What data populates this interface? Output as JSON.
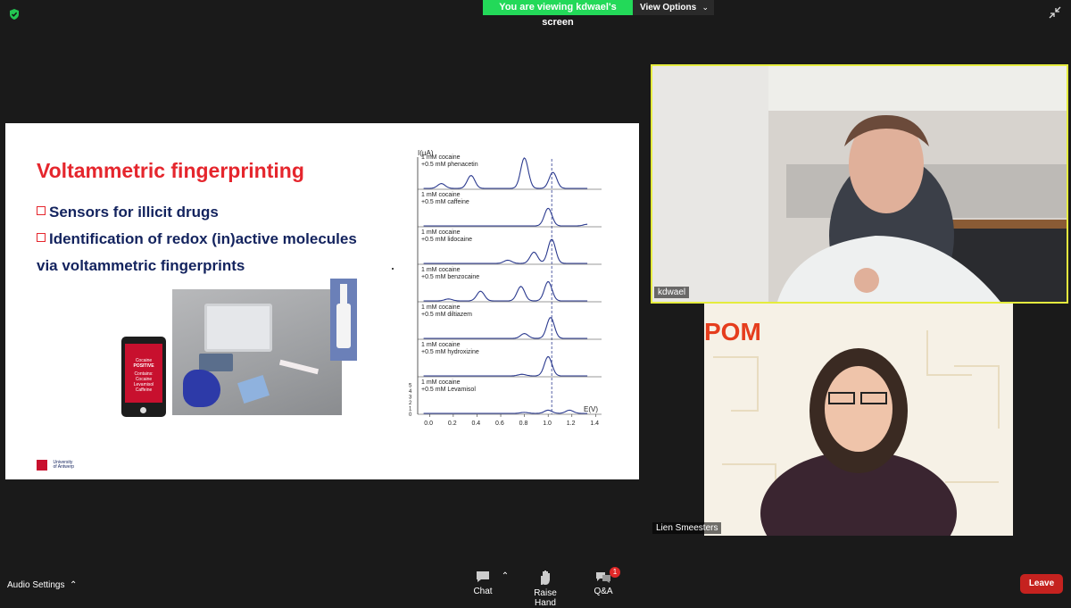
{
  "top_bar": {
    "viewing_banner": "You are viewing kdwael's screen",
    "view_options": "View Options",
    "security_icon": "shield-check-icon",
    "fullscreen_icon": "exit-fullscreen-icon"
  },
  "slide": {
    "title": "Voltammetric fingerprinting",
    "bullets": [
      "Sensors for illicit drugs",
      "Identification of redox (in)active molecules",
      "via voltammetric fingerprints"
    ],
    "phone": {
      "line1": "Cocaine",
      "line2": "POSITIVE",
      "line3": "Contains:",
      "line4": "Cocaine",
      "line5": "Levamisol",
      "line6": "Caffeine"
    },
    "logo": {
      "line1": "University",
      "line2": "of Antwerp"
    },
    "colors": {
      "title": "#e5262d",
      "bullet_text": "#13235e",
      "curve": "#2b3a8f"
    }
  },
  "chart_data": {
    "type": "line",
    "ylabel": "I(µA)",
    "xlabel": "E(V)",
    "xlim": [
      -0.1,
      1.45
    ],
    "x_ticks": [
      "0.0",
      "0.2",
      "0.4",
      "0.6",
      "0.8",
      "1.0",
      "1.2",
      "1.4"
    ],
    "y_ticks": [
      "0",
      "1",
      "2",
      "3",
      "4",
      "5"
    ],
    "reference_line_x": 1.03,
    "series": [
      {
        "name": "1 mM cocaine +0.5 mM phenacetin",
        "peaks": [
          [
            0.1,
            0.15
          ],
          [
            0.35,
            0.4
          ],
          [
            0.8,
            0.95
          ],
          [
            1.04,
            0.5
          ]
        ]
      },
      {
        "name": "1 mM cocaine +0.5 mM caffeine",
        "peaks": [
          [
            1.0,
            0.55
          ],
          [
            1.33,
            0.05
          ]
        ]
      },
      {
        "name": "1 mM cocaine +0.5 mM lidocaine",
        "peaks": [
          [
            0.66,
            0.1
          ],
          [
            0.88,
            0.35
          ],
          [
            1.03,
            0.75
          ]
        ]
      },
      {
        "name": "1 mM cocaine +0.5 mM benzocaine",
        "peaks": [
          [
            0.16,
            0.06
          ],
          [
            0.43,
            0.3
          ],
          [
            0.77,
            0.45
          ],
          [
            1.0,
            0.6
          ]
        ]
      },
      {
        "name": "1 mM cocaine +0.5 mM diltiazem",
        "peaks": [
          [
            0.8,
            0.15
          ],
          [
            1.02,
            0.65
          ]
        ]
      },
      {
        "name": "1 mM cocaine +0.5 mM hydroxizine",
        "peaks": [
          [
            0.78,
            0.05
          ],
          [
            1.0,
            0.6
          ]
        ]
      },
      {
        "name": "1 mM cocaine +0.5 mM Levamisol",
        "peaks": [
          [
            0.8,
            0.03
          ],
          [
            1.0,
            0.1
          ],
          [
            1.18,
            0.1
          ]
        ]
      }
    ]
  },
  "participants": {
    "speaker_name": "kdwael",
    "second_name": "Lien Smeesters",
    "second_bg_text": "POM"
  },
  "bottom_bar": {
    "audio_settings": "Audio Settings",
    "chat": "Chat",
    "raise_hand": "Raise Hand",
    "qa": "Q&A",
    "qa_badge": "1",
    "leave": "Leave",
    "leave_color": "#c5221f"
  }
}
